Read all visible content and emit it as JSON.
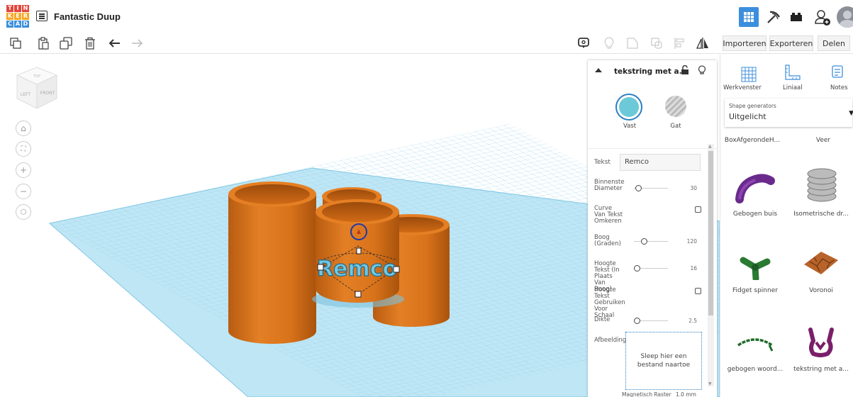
{
  "header": {
    "logo_letters": [
      "T",
      "I",
      "N",
      "K",
      "E",
      "R",
      "C",
      "A",
      "D"
    ],
    "title": "Fantastic Duup"
  },
  "right_toolbar": {
    "import_label": "Importeren",
    "export_label": "Exporteren",
    "share_label": "Delen"
  },
  "viewcube": {
    "top": "TOP",
    "left": "LEFT",
    "front": "FRONT"
  },
  "inspector": {
    "title": "tekstring met a...",
    "solid_label": "Vast",
    "hole_label": "Gat",
    "text_label": "Tekst",
    "text_value": "Remco",
    "props": [
      {
        "label": "Binnenste Diameter",
        "value": "30"
      },
      {
        "label": "Curve Van Tekst Omkeren",
        "checked": false
      },
      {
        "label": "Boog (Graden)",
        "value": "120"
      },
      {
        "label": "Hoogte Tekst (In Plaats Van Boog)",
        "value": "16"
      },
      {
        "label": "Hoogte Tekst Gebruiken Voor Schaal",
        "checked": false
      },
      {
        "label": "Dikte",
        "value": "2.5"
      }
    ],
    "image_label": "Afbeelding",
    "drop_text": "Sleep hier een bestand naartoe",
    "snap_label": "Magnetisch Raster",
    "snap_value": "1.0 mm"
  },
  "library": {
    "workplane_label": "Werkvenster",
    "ruler_label": "Liniaal",
    "notes_label": "Notes",
    "category_caption": "Shape generators",
    "category_value": "Uitgelicht",
    "top_items": [
      "BoxAfgerondeH...",
      "Veer"
    ],
    "items": [
      "Gebogen buis",
      "Isometrische dr...",
      "Fidget spinner",
      "Voronoi",
      "gebogen woord...",
      "tekstring met a..."
    ]
  },
  "scene": {
    "model_text": "Remco",
    "object_color": "#e07b22",
    "grid_color": "#a9dcef",
    "accent_blue": "#3c8fdc"
  }
}
